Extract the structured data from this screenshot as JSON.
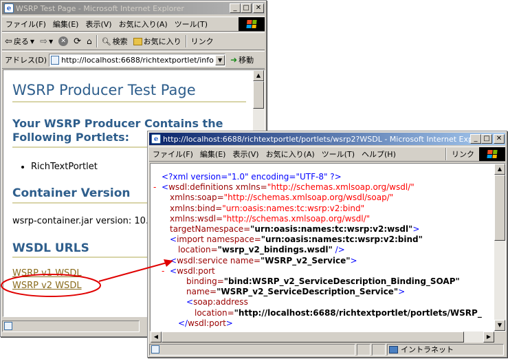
{
  "back_window": {
    "title": "WSRP Test Page - Microsoft Internet Explorer",
    "menu": [
      "ファイル(F)",
      "編集(E)",
      "表示(V)",
      "お気に入り(A)",
      "ツール(T)"
    ],
    "toolbar": {
      "back_label": "戻る",
      "search_label": "検索",
      "favorites_label": "お気に入り",
      "links_label": "リンク"
    },
    "address": {
      "label": "アドレス(D)",
      "value": "http://localhost:6688/richtextportlet/info",
      "go_label": "移動"
    },
    "page": {
      "heading": "WSRP Producer Test Page",
      "portlets_heading_line1": "Your WSRP Producer Contains the",
      "portlets_heading_line2": "Following Portlets:",
      "portlets": [
        "RichTextPortlet"
      ],
      "container_heading": "Container Version",
      "container_text": "wsrp-container.jar version: 10.",
      "wsdl_heading": "WSDL URLS",
      "wsdl_links": [
        "WSRP v1 WSDL",
        "WSRP v2 WSDL"
      ]
    }
  },
  "front_window": {
    "title": "http://localhost:6688/richtextportlet/portlets/wsrp2?WSDL - Microsoft Internet Explo...",
    "menu": [
      "ファイル(F)",
      "編集(E)",
      "表示(V)",
      "お気に入り(A)",
      "ツール(T)",
      "ヘルプ(H)"
    ],
    "links_label": "リンク",
    "xml_lines": [
      {
        "indent": 0,
        "minus": false,
        "parts": [
          {
            "c": "blue",
            "t": "<?xml version=\"1.0\" encoding=\"UTF-8\" ?>"
          }
        ]
      },
      {
        "indent": 0,
        "minus": true,
        "parts": [
          {
            "c": "blue",
            "t": "<"
          },
          {
            "c": "maroon",
            "t": "wsdl:definitions xmlns="
          },
          {
            "c": "red",
            "t": "\"http://schemas.xmlsoap.org/wsdl/\""
          }
        ]
      },
      {
        "indent": 1,
        "minus": false,
        "parts": [
          {
            "c": "maroon",
            "t": "xmlns:soap="
          },
          {
            "c": "red",
            "t": "\"http://schemas.xmlsoap.org/wsdl/soap/\""
          }
        ]
      },
      {
        "indent": 1,
        "minus": false,
        "parts": [
          {
            "c": "maroon",
            "t": "xmlns:bind="
          },
          {
            "c": "red",
            "t": "\"urn:oasis:names:tc:wsrp:v2:bind\""
          }
        ]
      },
      {
        "indent": 1,
        "minus": false,
        "parts": [
          {
            "c": "maroon",
            "t": "xmlns:wsdl="
          },
          {
            "c": "red",
            "t": "\"http://schemas.xmlsoap.org/wsdl/\""
          }
        ]
      },
      {
        "indent": 1,
        "minus": false,
        "parts": [
          {
            "c": "maroon",
            "t": "targetNamespace="
          },
          {
            "c": "black",
            "t": "\"urn:oasis:names:tc:wsrp:v2:wsdl\""
          },
          {
            "c": "blue",
            "t": ">"
          }
        ]
      },
      {
        "indent": 1,
        "minus": false,
        "parts": [
          {
            "c": "blue",
            "t": "<"
          },
          {
            "c": "maroon",
            "t": "import namespace="
          },
          {
            "c": "black",
            "t": "\"urn:oasis:names:tc:wsrp:v2:bind\""
          }
        ]
      },
      {
        "indent": 2,
        "minus": false,
        "parts": [
          {
            "c": "maroon",
            "t": "location="
          },
          {
            "c": "black",
            "t": "\"wsrp_v2_bindings.wsdl\""
          },
          {
            "c": "blue",
            "t": " />"
          }
        ]
      },
      {
        "indent": 1,
        "minus": false,
        "parts": [
          {
            "c": "blue",
            "t": "<"
          },
          {
            "c": "maroon",
            "t": "wsdl:service name="
          },
          {
            "c": "black",
            "t": "\"WSRP_v2_Service\""
          },
          {
            "c": "blue",
            "t": ">"
          }
        ]
      },
      {
        "indent": 1,
        "minus": true,
        "parts": [
          {
            "c": "blue",
            "t": "<"
          },
          {
            "c": "maroon",
            "t": "wsdl:port"
          }
        ]
      },
      {
        "indent": 3,
        "minus": false,
        "parts": [
          {
            "c": "maroon",
            "t": "binding="
          },
          {
            "c": "black",
            "t": "\"bind:WSRP_v2_ServiceDescription_Binding_SOAP\""
          }
        ]
      },
      {
        "indent": 3,
        "minus": false,
        "parts": [
          {
            "c": "maroon",
            "t": "name="
          },
          {
            "c": "black",
            "t": "\"WSRP_v2_ServiceDescription_Service\""
          },
          {
            "c": "blue",
            "t": ">"
          }
        ]
      },
      {
        "indent": 3,
        "minus": false,
        "parts": [
          {
            "c": "blue",
            "t": "<"
          },
          {
            "c": "maroon",
            "t": "soap:address"
          }
        ]
      },
      {
        "indent": 4,
        "minus": false,
        "parts": [
          {
            "c": "maroon",
            "t": "location="
          },
          {
            "c": "black",
            "t": "\"http://localhost:6688/richtextportlet/portlets/WSRP_"
          }
        ]
      },
      {
        "indent": 2,
        "minus": false,
        "parts": [
          {
            "c": "blue",
            "t": "</"
          },
          {
            "c": "maroon",
            "t": "wsdl:port"
          },
          {
            "c": "blue",
            "t": ">"
          }
        ]
      }
    ],
    "status": {
      "zone_label": "イントラネット"
    }
  },
  "colors": {
    "heading": "#2e5e8c",
    "annotation": "#e00000"
  }
}
